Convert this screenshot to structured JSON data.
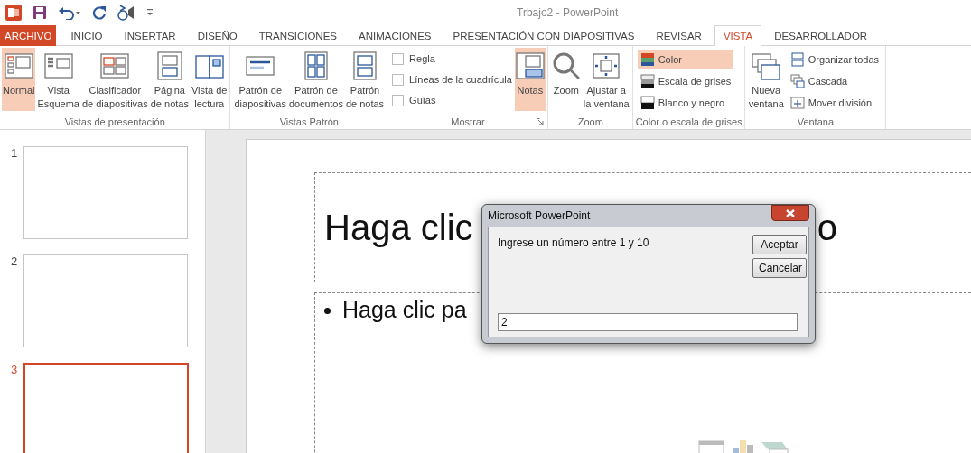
{
  "window": {
    "title": "Trbajo2 - PowerPoint"
  },
  "tabs": [
    {
      "label": "ARCHIVO",
      "kind": "file",
      "selected": false
    },
    {
      "label": "INICIO",
      "kind": "tab",
      "selected": false
    },
    {
      "label": "INSERTAR",
      "kind": "tab",
      "selected": false
    },
    {
      "label": "DISEÑO",
      "kind": "tab",
      "selected": false
    },
    {
      "label": "TRANSICIONES",
      "kind": "tab",
      "selected": false
    },
    {
      "label": "ANIMACIONES",
      "kind": "tab",
      "selected": false
    },
    {
      "label": "PRESENTACIÓN CON DIAPOSITIVAS",
      "kind": "tab",
      "selected": false
    },
    {
      "label": "REVISAR",
      "kind": "tab",
      "selected": false
    },
    {
      "label": "VISTA",
      "kind": "tab",
      "selected": true
    },
    {
      "label": "DESARROLLADOR",
      "kind": "tab",
      "selected": false
    }
  ],
  "ribbon": [
    {
      "label": "Vistas de presentación",
      "items": [
        {
          "kind": "large",
          "lines": [
            "Normal"
          ],
          "selected": true
        },
        {
          "kind": "large",
          "lines": [
            "Vista",
            "Esquema"
          ],
          "selected": false
        },
        {
          "kind": "large",
          "lines": [
            "Clasificador",
            "de diapositivas"
          ],
          "selected": false
        },
        {
          "kind": "large",
          "lines": [
            "Página",
            "de notas"
          ],
          "selected": false
        },
        {
          "kind": "large",
          "lines": [
            "Vista de",
            "lectura"
          ],
          "selected": false
        }
      ]
    },
    {
      "label": "Vistas Patrón",
      "items": [
        {
          "kind": "large",
          "lines": [
            "Patrón de",
            "diapositivas"
          ],
          "selected": false
        },
        {
          "kind": "large",
          "lines": [
            "Patrón de",
            "documentos"
          ],
          "selected": false
        },
        {
          "kind": "large",
          "lines": [
            "Patrón",
            "de notas"
          ],
          "selected": false
        }
      ]
    },
    {
      "label": "Mostrar",
      "items": [
        {
          "kind": "checks",
          "checks": [
            {
              "label": "Regla",
              "checked": false
            },
            {
              "label": "Líneas de la cuadrícula",
              "checked": false
            },
            {
              "label": "Guías",
              "checked": false
            }
          ]
        },
        {
          "kind": "large",
          "lines": [
            "Notas"
          ],
          "selected": true
        }
      ]
    },
    {
      "label": "Zoom",
      "items": [
        {
          "kind": "large",
          "lines": [
            "Zoom"
          ],
          "selected": false
        },
        {
          "kind": "large",
          "lines": [
            "Ajustar a",
            "la ventana"
          ],
          "selected": false
        }
      ]
    },
    {
      "label": "Color o escala de grises",
      "items": [
        {
          "kind": "smalls",
          "smalls": [
            {
              "label": "Color",
              "selected": true
            },
            {
              "label": "Escala de grises",
              "selected": false
            },
            {
              "label": "Blanco y negro",
              "selected": false
            }
          ]
        }
      ]
    },
    {
      "label": "Ventana",
      "items": [
        {
          "kind": "large",
          "lines": [
            "Nueva",
            "ventana"
          ],
          "selected": false
        },
        {
          "kind": "smalls",
          "smalls": [
            {
              "label": "Organizar todas",
              "selected": false
            },
            {
              "label": "Cascada",
              "selected": false
            },
            {
              "label": "Mover división",
              "selected": false
            }
          ]
        }
      ]
    }
  ],
  "slides": [
    {
      "number": "1",
      "selected": false
    },
    {
      "number": "2",
      "selected": false
    },
    {
      "number": "3",
      "selected": true
    }
  ],
  "slide": {
    "title_left": "Haga clic",
    "title_right": "o",
    "body": "Haga clic pa"
  },
  "dialog": {
    "title": "Microsoft PowerPoint",
    "prompt": "Ingrese un número entre 1 y 10",
    "buttons": [
      "Aceptar",
      "Cancelar"
    ],
    "value": "2"
  }
}
